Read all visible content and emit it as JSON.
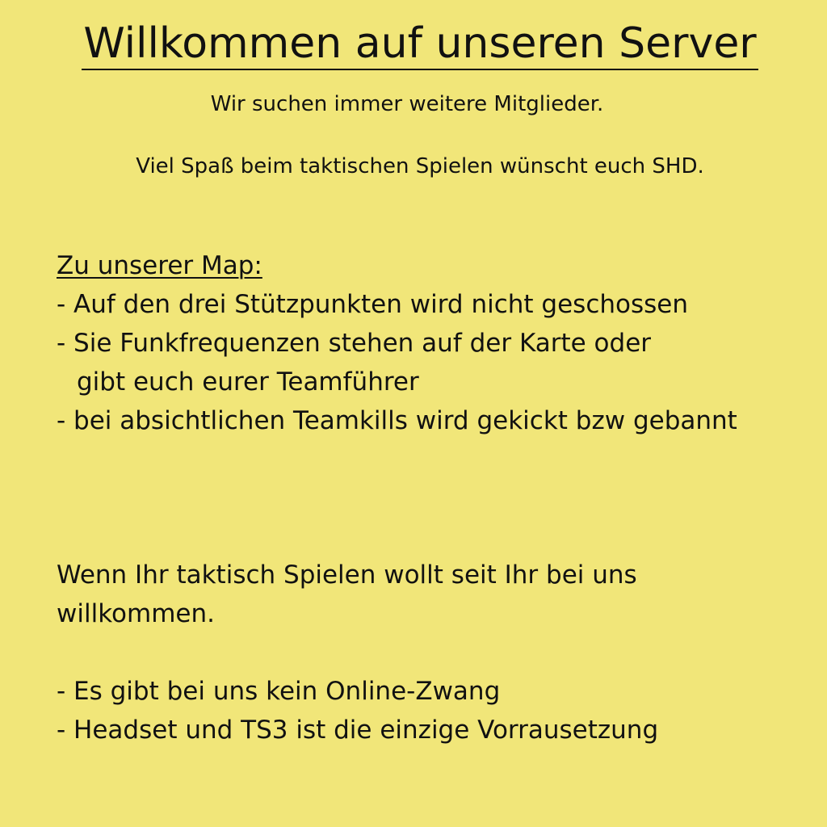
{
  "header": {
    "title": "Willkommen auf unseren Server",
    "line1": "Wir suchen immer weitere Mitglieder.",
    "line2": "Viel Spaß beim taktischen Spielen wünscht euch SHD."
  },
  "map_section": {
    "heading": "Zu unserer Map:",
    "rules": [
      "- Auf den drei Stützpunkten wird nicht geschossen",
      "- Sie Funkfrequenzen stehen auf der Karte oder",
      "gibt euch eurer Teamführer",
      "- bei absichtlichen Teamkills wird gekickt bzw gebannt"
    ]
  },
  "welcome": {
    "line1": "Wenn Ihr taktisch Spielen wollt seit Ihr bei uns",
    "line2": "willkommen."
  },
  "info": {
    "items": [
      "- Es gibt bei uns kein Online-Zwang",
      "- Headset und TS3 ist die einzige Vorrausetzung"
    ]
  }
}
